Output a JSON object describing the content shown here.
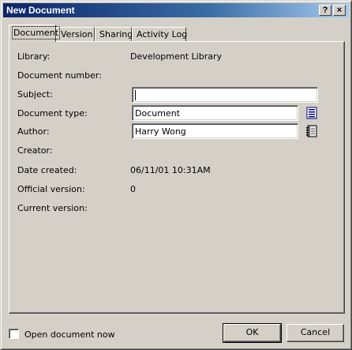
{
  "window": {
    "title": "New Document",
    "help_label": "?",
    "close_label": "×"
  },
  "tabs": [
    {
      "label": "Document",
      "active": true
    },
    {
      "label": "Version",
      "active": false
    },
    {
      "label": "Sharing",
      "active": false
    },
    {
      "label": "Activity Log",
      "active": false
    }
  ],
  "fields": {
    "library": {
      "label": "Library:",
      "value": "Development Library"
    },
    "document_number": {
      "label": "Document number:",
      "value": ""
    },
    "subject": {
      "label": "Subject:",
      "value": ""
    },
    "document_type": {
      "label": "Document type:",
      "value": "Document",
      "button_icon": "list-icon"
    },
    "author": {
      "label": "Author:",
      "value": "Harry Wong",
      "button_icon": "address-book-icon"
    },
    "creator": {
      "label": "Creator:",
      "value": ""
    },
    "date_created": {
      "label": "Date created:",
      "value": "06/11/01 10:31AM"
    },
    "official_version": {
      "label": "Official version:",
      "value": "0"
    },
    "current_version": {
      "label": "Current version:",
      "value": ""
    }
  },
  "footer": {
    "open_now_label": "Open document now",
    "open_now_checked": false,
    "ok_label": "OK",
    "cancel_label": "Cancel"
  }
}
